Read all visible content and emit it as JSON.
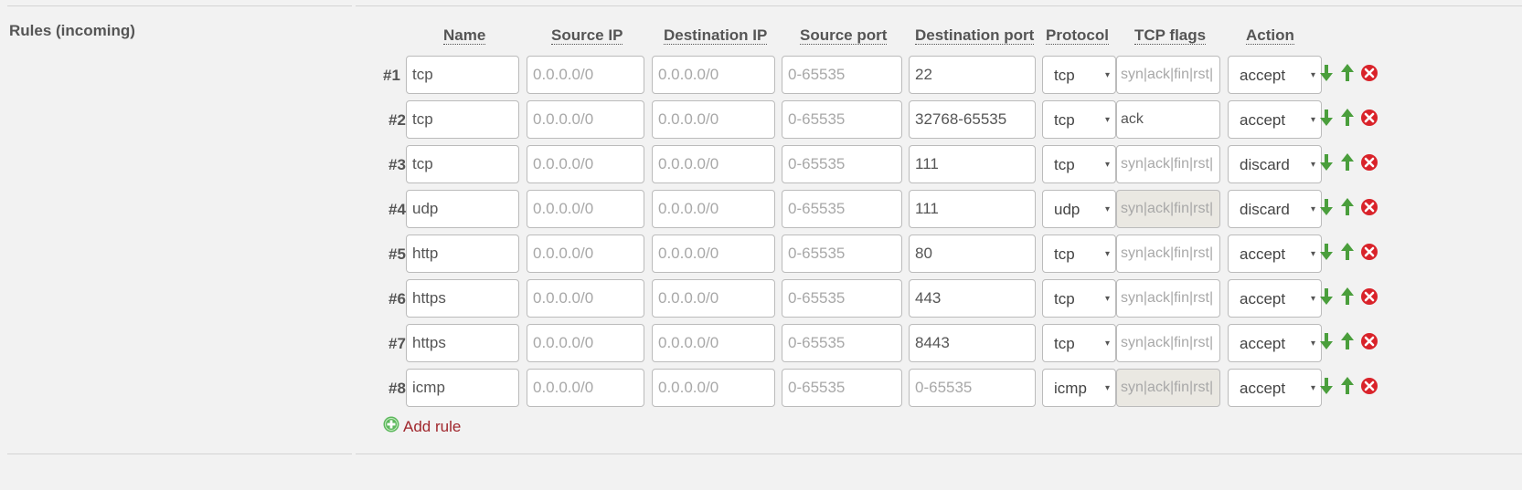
{
  "section_label": "Rules (incoming)",
  "columns": {
    "name": "Name",
    "source_ip": "Source IP",
    "destination_ip": "Destination IP",
    "source_port": "Source port",
    "destination_port": "Destination port",
    "protocol": "Protocol",
    "tcp_flags": "TCP flags",
    "action": "Action"
  },
  "placeholders": {
    "source_ip": "0.0.0.0/0",
    "destination_ip": "0.0.0.0/0",
    "source_port": "0-65535",
    "destination_port": "0-65535",
    "tcp_flags": "syn|ack|fin|rst|"
  },
  "rules": [
    {
      "num": "#1",
      "name": "tcp",
      "destination_port": "22",
      "protocol": "tcp",
      "tcp_flags": "",
      "flags_disabled": false,
      "action": "accept"
    },
    {
      "num": "#2",
      "name": "tcp",
      "destination_port": "32768-65535",
      "protocol": "tcp",
      "tcp_flags": "ack",
      "flags_disabled": false,
      "action": "accept"
    },
    {
      "num": "#3",
      "name": "tcp",
      "destination_port": "111",
      "protocol": "tcp",
      "tcp_flags": "",
      "flags_disabled": false,
      "action": "discard"
    },
    {
      "num": "#4",
      "name": "udp",
      "destination_port": "111",
      "protocol": "udp",
      "tcp_flags": "",
      "flags_disabled": true,
      "action": "discard"
    },
    {
      "num": "#5",
      "name": "http",
      "destination_port": "80",
      "protocol": "tcp",
      "tcp_flags": "",
      "flags_disabled": false,
      "action": "accept"
    },
    {
      "num": "#6",
      "name": "https",
      "destination_port": "443",
      "protocol": "tcp",
      "tcp_flags": "",
      "flags_disabled": false,
      "action": "accept"
    },
    {
      "num": "#7",
      "name": "https",
      "destination_port": "8443",
      "protocol": "tcp",
      "tcp_flags": "",
      "flags_disabled": false,
      "action": "accept"
    },
    {
      "num": "#8",
      "name": "icmp",
      "destination_port": "",
      "protocol": "icmp",
      "tcp_flags": "",
      "flags_disabled": true,
      "action": "accept"
    }
  ],
  "row_icons": [
    "arrow-down-icon",
    "arrow-up-icon",
    "delete-icon"
  ],
  "add_rule_label": "Add rule",
  "colors": {
    "background": "#f2f2f2",
    "link": "#a0262c",
    "move_arrow": "#4a9e3c",
    "delete": "#d9232a",
    "add": "#5cb85c"
  }
}
